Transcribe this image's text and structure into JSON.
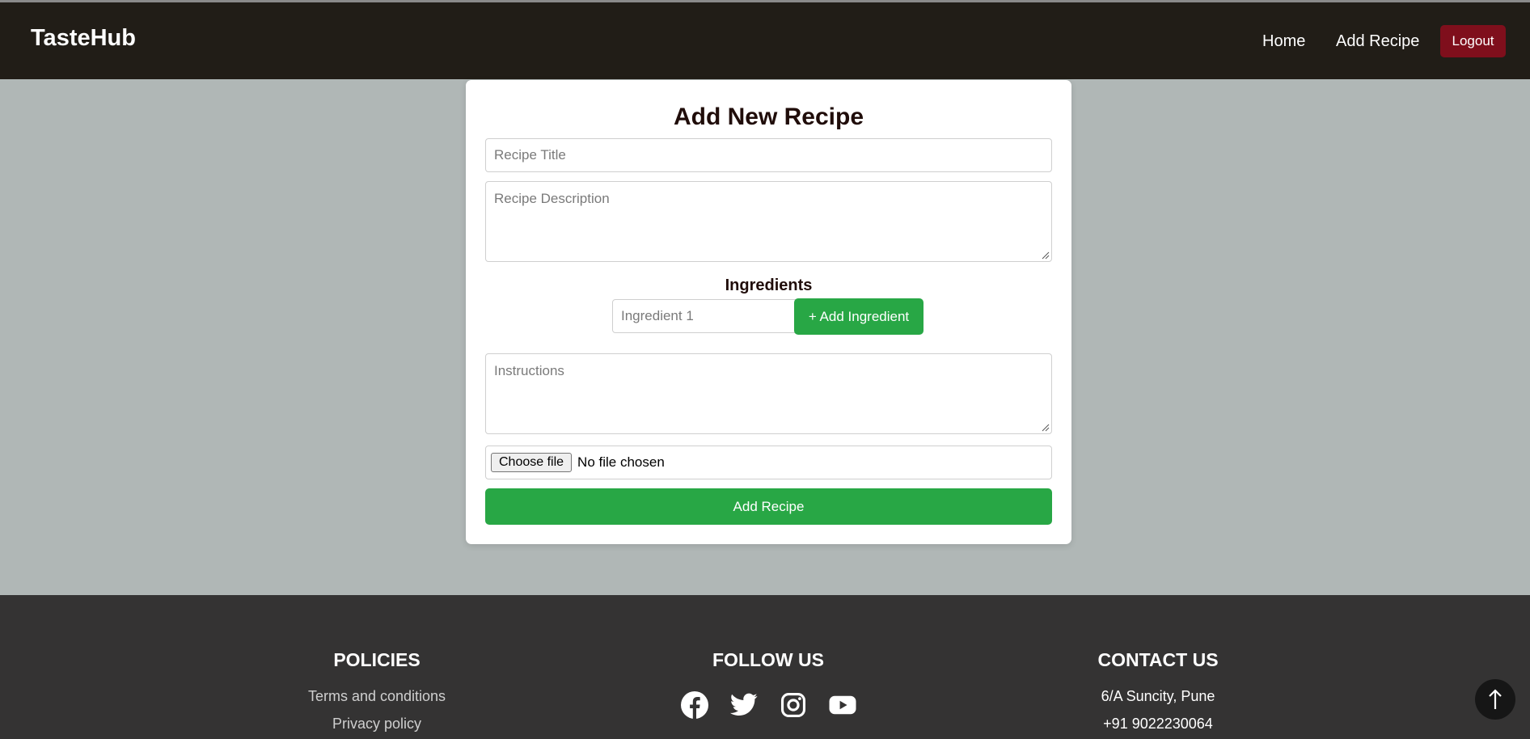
{
  "header": {
    "brand": "TasteHub",
    "nav": [
      {
        "label": "Home"
      },
      {
        "label": "Add Recipe"
      }
    ],
    "logout_label": "Logout",
    "background": "#211d17",
    "logout_color": "#7f0f1c"
  },
  "form": {
    "title": "Add New Recipe",
    "recipe_title_placeholder": "Recipe Title",
    "recipe_description_placeholder": "Recipe Description",
    "ingredients_heading": "Ingredients",
    "ingredient_placeholder": "Ingredient 1",
    "add_ingredient_label": "+ Add Ingredient",
    "instructions_placeholder": "Instructions",
    "file_button_label": "Choose file",
    "file_status": "No file chosen",
    "submit_label": "Add Recipe",
    "accent_color": "#28a745"
  },
  "footer": {
    "policies": {
      "heading": "POLICIES",
      "links": [
        "Terms and conditions",
        "Privacy policy"
      ]
    },
    "follow": {
      "heading": "FOLLOW US",
      "icons": [
        "facebook-icon",
        "twitter-icon",
        "instagram-icon",
        "youtube-icon"
      ]
    },
    "contact": {
      "heading": "CONTACT US",
      "address": "6/A Suncity, Pune",
      "phone": "+91 9022230064"
    },
    "background": "#343333"
  },
  "scroll_top": {
    "icon": "arrow-up-icon",
    "glyph": "↑"
  }
}
